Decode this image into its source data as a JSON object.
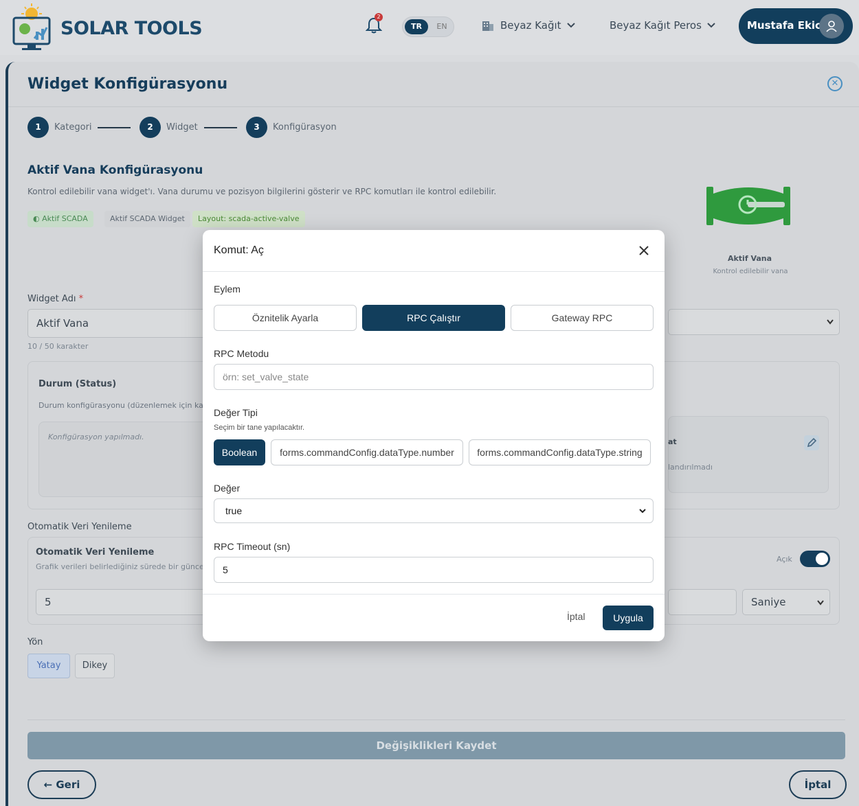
{
  "header": {
    "brand": "SOLAR TOOLS",
    "notification_count": "2",
    "lang_active": "TR",
    "lang_other": "EN",
    "workspace": "Beyaz Kağıt",
    "site": "Beyaz Kağıt Peros",
    "user_name": "Mustafa Ekici"
  },
  "panel": {
    "title": "Widget Konfigürasyonu",
    "steps": [
      {
        "num": "1",
        "label": "Kategori"
      },
      {
        "num": "2",
        "label": "Widget"
      },
      {
        "num": "3",
        "label": "Konfigürasyon"
      }
    ],
    "config_title": "Aktif Vana Konfigürasyonu",
    "config_desc": "Kontrol edilebilir vana widget'ı. Vana durumu ve pozisyon bilgilerini gösterir ve RPC komutları ile kontrol edilebilir.",
    "tags": [
      "Aktif SCADA",
      "Aktif SCADA Widget",
      "Layout: scada-active-valve"
    ],
    "preview_name": "Aktif Vana",
    "preview_sub": "Kontrol edilebilir vana",
    "widget_name_label": "Widget Adı",
    "widget_name_value": "Aktif Vana",
    "char_count": "10 / 50 karakter",
    "status_title": "Durum (Status)",
    "status_desc": "Durum konfigürasyonu (düzenlemek için kalem",
    "not_configured": "Konfigürasyon yapılmadı.",
    "right_card_label": "at",
    "right_card_sub": "landırılmadı",
    "auto_refresh_section": "Otomatik Veri Yenileme",
    "auto_refresh_title": "Otomatik Veri Yenileme",
    "auto_refresh_desc": "Grafik verileri belirlediğiniz sürede bir güncellen",
    "toggle_label": "Açık",
    "refresh_value": "5",
    "refresh_unit": "Saniye",
    "direction_label": "Yön",
    "dir_horizontal": "Yatay",
    "dir_vertical": "Dikey",
    "save_label": "Değişiklikleri Kaydet",
    "back_label": "← Geri",
    "cancel_label": "İptal"
  },
  "modal": {
    "title": "Komut: Aç",
    "action_label": "Eylem",
    "actions": [
      "Öznitelik Ayarla",
      "RPC Çalıştır",
      "Gateway RPC"
    ],
    "active_action_index": 1,
    "rpc_method_label": "RPC Metodu",
    "rpc_method_placeholder": "örn: set_valve_state",
    "value_type_label": "Değer Tipi",
    "value_type_help": "Seçim bir tane yapılacaktır.",
    "value_types": [
      "Boolean",
      "forms.commandConfig.dataType.number",
      "forms.commandConfig.dataType.string"
    ],
    "value_label": "Değer",
    "value_selected": "true",
    "timeout_label": "RPC Timeout (sn)",
    "timeout_value": "5",
    "cancel_label": "İptal",
    "apply_label": "Uygula"
  },
  "colors": {
    "primary": "#123e5c",
    "accent_blue": "#4a90c2",
    "valve_green": "#2f9a3e"
  }
}
